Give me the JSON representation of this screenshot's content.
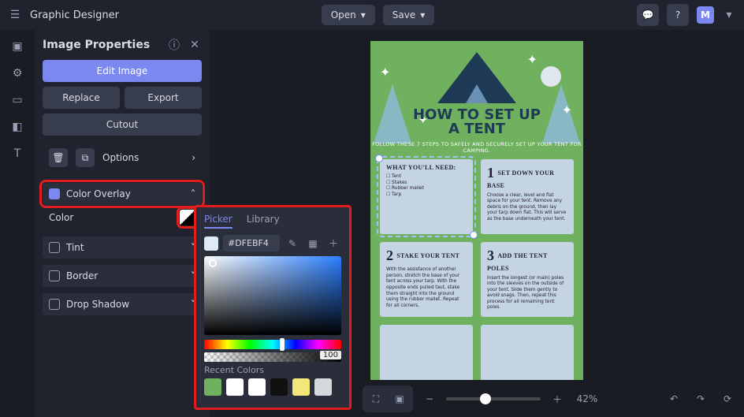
{
  "app": {
    "name": "Graphic Designer"
  },
  "top": {
    "open": "Open",
    "save": "Save",
    "avatar": "M"
  },
  "panel": {
    "title": "Image Properties",
    "edit": "Edit Image",
    "replace": "Replace",
    "export": "Export",
    "cutout": "Cutout",
    "options": "Options",
    "sections": {
      "colorOverlay": "Color Overlay",
      "colorLabel": "Color",
      "tint": "Tint",
      "border": "Border",
      "dropShadow": "Drop Shadow"
    }
  },
  "picker": {
    "tabPicker": "Picker",
    "tabLibrary": "Library",
    "hex": "#DFEBF4",
    "opacity": "100",
    "recentLabel": "Recent Colors",
    "recent": [
      "#6fb15e",
      "#ffffff",
      "#ffffff",
      "#111111",
      "#f2e87a",
      "#d5d8dc"
    ]
  },
  "doc": {
    "title1": "HOW TO SET UP",
    "title2": "A TENT",
    "subtitle": "FOLLOW THESE 7 STEPS TO SAFELY AND SECURELY SET UP YOUR TENT FOR CAMPING.",
    "c1": {
      "h": "WHAT YOU'LL NEED:",
      "b": "☐ Tent\n☐ Stakes\n☐ Rubber mallet\n☐ Tarp"
    },
    "c2": {
      "n": "1",
      "h": "SET DOWN YOUR BASE",
      "b": "Choose a clear, level and flat space for your tent. Remove any debris on the ground, then lay your tarp down flat. This will serve as the base underneath your tent."
    },
    "c3": {
      "n": "2",
      "h": "STAKE YOUR TENT",
      "b": "With the assistance of another person, stretch the base of your tent across your tarp. With the opposite ends pulled taut, stake them straight into the ground using the rubber mallet. Repeat for all corners."
    },
    "c4": {
      "n": "3",
      "h": "ADD THE TENT POLES",
      "b": "Insert the longest (or main) poles into the sleeves on the outside of your tent. Slide them gently to avoid snags. Then, repeat this process for all remaining tent poles."
    }
  },
  "zoom": {
    "pct": "42%"
  }
}
